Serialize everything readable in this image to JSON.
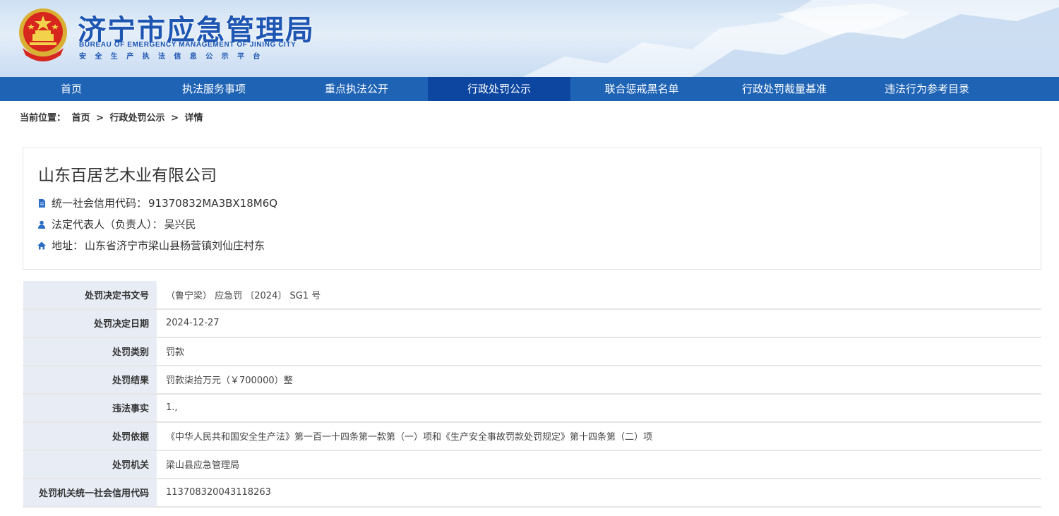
{
  "header": {
    "title": "济宁市应急管理局",
    "subtitle_en": "BUREAU OF EMERGENCY MANAGEMENT OF JINING CITY",
    "subtitle_cn": "安全生产执法信息公示平台",
    "brand_color": "#1e56b3"
  },
  "nav": {
    "items": [
      {
        "label": "首页"
      },
      {
        "label": "执法服务事项"
      },
      {
        "label": "重点执法公开"
      },
      {
        "label": "行政处罚公示",
        "active": true
      },
      {
        "label": "联合惩戒黑名单"
      },
      {
        "label": "行政处罚裁量基准"
      },
      {
        "label": "违法行为参考目录"
      }
    ],
    "bg_color": "#1f63b5",
    "active_color": "#0c46a0"
  },
  "breadcrumb": {
    "prefix": "当前位置：",
    "home": "首页",
    "sep": ">",
    "section": "行政处罚公示",
    "current": "详情"
  },
  "company": {
    "name": "山东百居艺木业有限公司",
    "credit_code_label": "统一社会信用代码：",
    "credit_code": "91370832MA3BX18M6Q",
    "legal_rep_label": "法定代表人（负责人）：",
    "legal_rep": "吴兴民",
    "address_label": "地址：",
    "address": "山东省济宁市梁山县杨营镇刘仙庄村东",
    "icons": [
      "document-icon",
      "user-icon",
      "home-icon"
    ]
  },
  "details": [
    {
      "key": "处罚决定书文号",
      "value": "（鲁宁梁） 应急罚 〔2024〕 SG1 号"
    },
    {
      "key": "处罚决定日期",
      "value": "2024-12-27"
    },
    {
      "key": "处罚类别",
      "value": "罚款"
    },
    {
      "key": "处罚结果",
      "value": "罚款柒拾万元（￥700000）整"
    },
    {
      "key": "违法事实",
      "value": "1.,"
    },
    {
      "key": "处罚依据",
      "value": "《中华人民共和国安全生产法》第一百一十四条第一款第（一）项和《生产安全事故罚款处罚规定》第十四条第（二）项"
    },
    {
      "key": "处罚机关",
      "value": "梁山县应急管理局"
    },
    {
      "key": "处罚机关统一社会信用代码",
      "value": "113708320043118263"
    }
  ]
}
